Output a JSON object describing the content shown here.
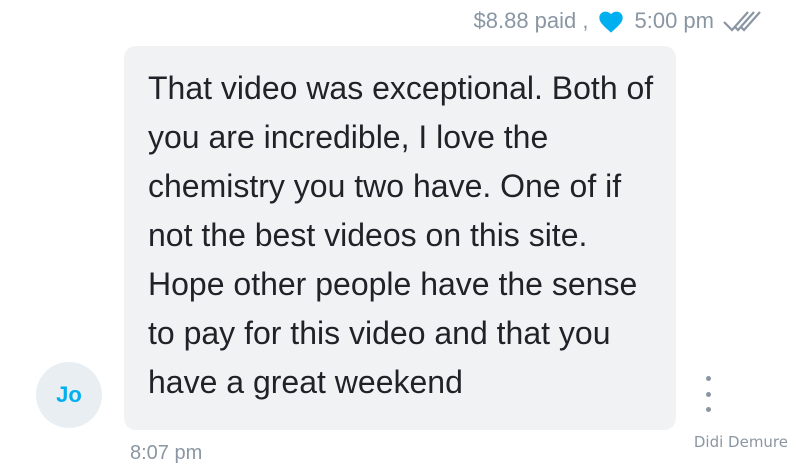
{
  "message": {
    "paid_label": "$8.88 paid ,",
    "sent_time": "5:00 pm",
    "text": "That video was exceptional. Both of you are incredible, I love the chemistry you two have. One of if not the best videos on this site. Hope other people have the sense to pay for this video and that you have a great weekend",
    "received_time": "8:07 pm"
  },
  "avatar": {
    "initials": "Jo"
  },
  "watermark": "Didi Demure",
  "icons": {
    "liked": "heart-icon",
    "read_receipt": "double-check-icon",
    "more": "more-vertical-icon"
  },
  "colors": {
    "accent": "#00aff0",
    "muted_text": "#8a96a3",
    "bubble_bg": "#f1f2f4"
  }
}
